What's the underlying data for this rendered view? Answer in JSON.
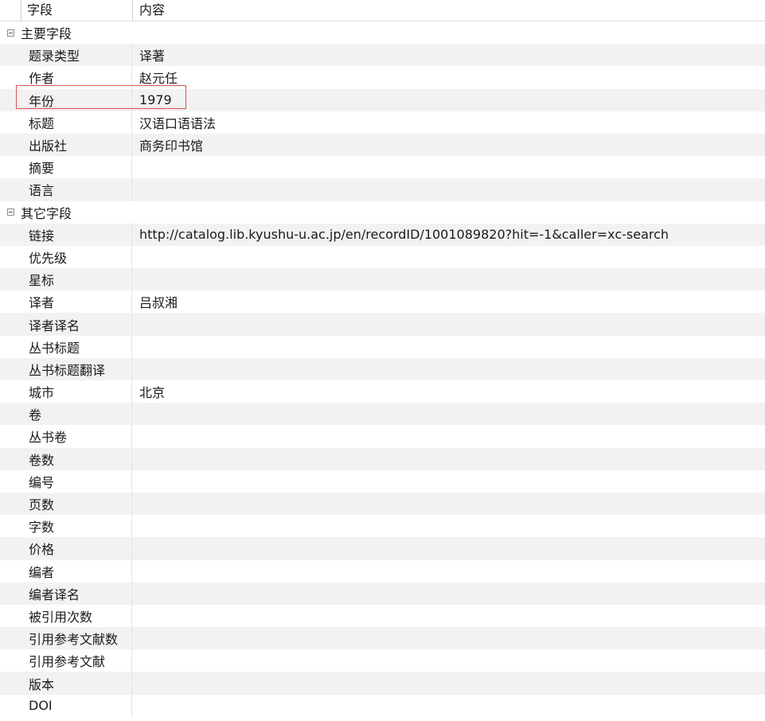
{
  "header": {
    "field": "字段",
    "value": "内容"
  },
  "groups": [
    {
      "label": "主要字段",
      "rows": [
        {
          "field": "题录类型",
          "value": "译著"
        },
        {
          "field": "作者",
          "value": "赵元任"
        },
        {
          "field": "年份",
          "value": "1979"
        },
        {
          "field": "标题",
          "value": "汉语口语语法"
        },
        {
          "field": "出版社",
          "value": "商务印书馆"
        },
        {
          "field": "摘要",
          "value": ""
        },
        {
          "field": "语言",
          "value": ""
        }
      ]
    },
    {
      "label": "其它字段",
      "rows": [
        {
          "field": "链接",
          "value": "http://catalog.lib.kyushu-u.ac.jp/en/recordID/1001089820?hit=-1&caller=xc-search"
        },
        {
          "field": "优先级",
          "value": ""
        },
        {
          "field": "星标",
          "value": ""
        },
        {
          "field": "译者",
          "value": "吕叔湘"
        },
        {
          "field": "译者译名",
          "value": ""
        },
        {
          "field": "丛书标题",
          "value": ""
        },
        {
          "field": "丛书标题翻译",
          "value": ""
        },
        {
          "field": "城市",
          "value": "北京"
        },
        {
          "field": "卷",
          "value": ""
        },
        {
          "field": "丛书卷",
          "value": ""
        },
        {
          "field": "卷数",
          "value": ""
        },
        {
          "field": "编号",
          "value": ""
        },
        {
          "field": "页数",
          "value": ""
        },
        {
          "field": "字数",
          "value": ""
        },
        {
          "field": "价格",
          "value": ""
        },
        {
          "field": "编者",
          "value": ""
        },
        {
          "field": "编者译名",
          "value": ""
        },
        {
          "field": "被引用次数",
          "value": ""
        },
        {
          "field": "引用参考文献数",
          "value": ""
        },
        {
          "field": "引用参考文献",
          "value": ""
        },
        {
          "field": "版本",
          "value": ""
        },
        {
          "field": "DOI",
          "value": ""
        }
      ]
    }
  ]
}
